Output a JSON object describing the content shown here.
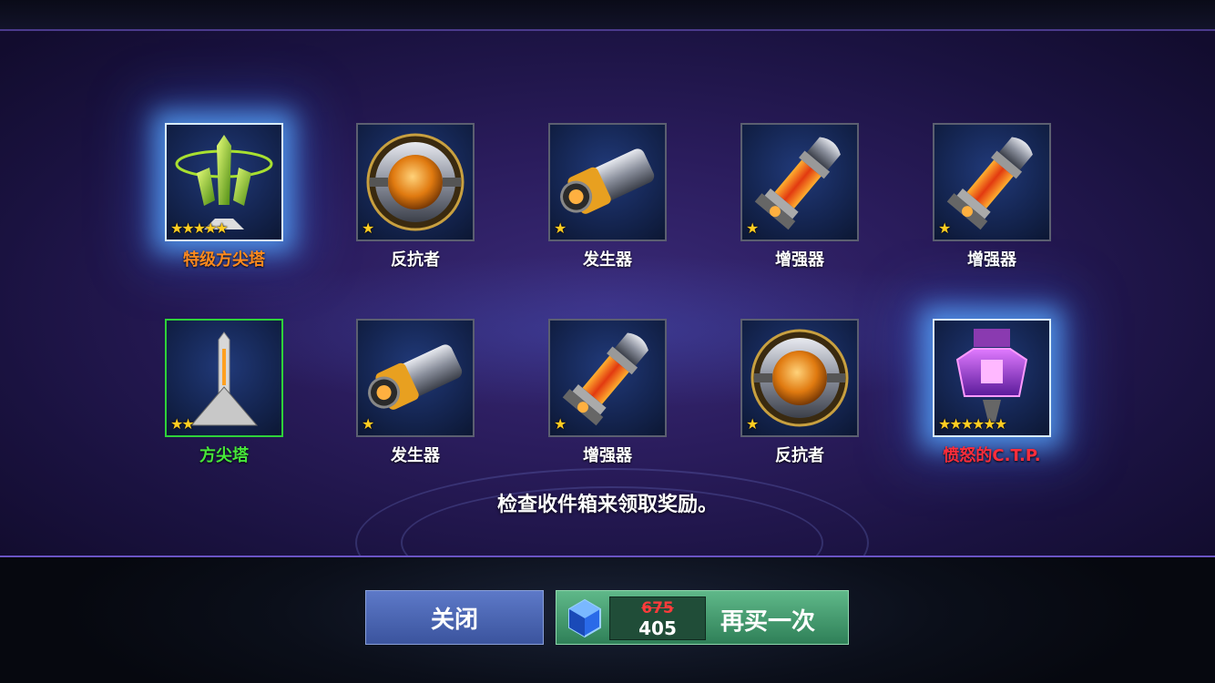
{
  "rewards_row1": [
    {
      "name": "特级方尖塔",
      "stars": "★★★★★",
      "color": "orange",
      "icon": "super-obelisk-icon"
    },
    {
      "name": "反抗者",
      "stars": "★",
      "color": "white",
      "icon": "resister-orb-icon"
    },
    {
      "name": "发生器",
      "stars": "★",
      "color": "white",
      "icon": "generator-icon"
    },
    {
      "name": "增强器",
      "stars": "★",
      "color": "white",
      "icon": "booster-tube-icon"
    },
    {
      "name": "增强器",
      "stars": "★",
      "color": "white",
      "icon": "booster-tube-icon"
    }
  ],
  "rewards_row2": [
    {
      "name": "方尖塔",
      "stars": "★★",
      "color": "green",
      "icon": "obelisk-icon"
    },
    {
      "name": "发生器",
      "stars": "★",
      "color": "white",
      "icon": "generator-icon"
    },
    {
      "name": "增强器",
      "stars": "★",
      "color": "white",
      "icon": "booster-tube-icon"
    },
    {
      "name": "反抗者",
      "stars": "★",
      "color": "white",
      "icon": "resister-orb-icon"
    },
    {
      "name": "愤怒的C.T.P.",
      "stars": "★★★★★★",
      "color": "red",
      "icon": "angry-ctp-icon"
    }
  ],
  "message": "检查收件箱来领取奖励。",
  "buttons": {
    "close_label": "关闭",
    "buy_again_label": "再买一次",
    "old_price": "675",
    "new_price": "405",
    "currency_icon": "blue-crystal-icon"
  },
  "colors": {
    "orange": "#ff8a1e",
    "green": "#47e83a",
    "red": "#ff2d3b",
    "close_button": "#4a66b4",
    "buy_button": "#4a9e70"
  }
}
